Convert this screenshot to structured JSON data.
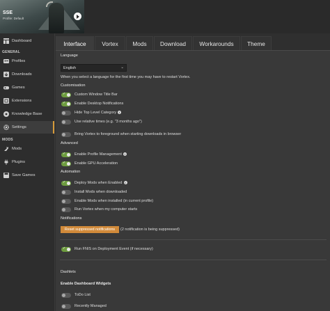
{
  "game": {
    "title": "SSE",
    "subtitle": "Profile: Default"
  },
  "sidebar": {
    "top_items": [
      {
        "label": "Dashboard",
        "icon": "dashboard-icon"
      }
    ],
    "general_label": "GENERAL",
    "general_items": [
      {
        "label": "Profiles",
        "icon": "profiles-icon"
      },
      {
        "label": "Downloads",
        "icon": "download-icon"
      },
      {
        "label": "Games",
        "icon": "gamepad-icon"
      },
      {
        "label": "Extensions",
        "icon": "extensions-icon"
      },
      {
        "label": "Knowledge Base",
        "icon": "knowledge-icon"
      },
      {
        "label": "Settings",
        "icon": "gear-icon",
        "active": true
      }
    ],
    "mods_label": "MODS",
    "mods_items": [
      {
        "label": "Mods",
        "icon": "mods-icon"
      },
      {
        "label": "Plugins",
        "icon": "plugins-icon"
      },
      {
        "label": "Save Games",
        "icon": "save-icon"
      }
    ]
  },
  "tabs": [
    {
      "label": "Interface",
      "active": true
    },
    {
      "label": "Vortex"
    },
    {
      "label": "Mods"
    },
    {
      "label": "Download"
    },
    {
      "label": "Workarounds"
    },
    {
      "label": "Theme"
    }
  ],
  "settings": {
    "language_label": "Language",
    "language_value": "English",
    "language_note": "When you select a language for the first time you may have to restart Vortex.",
    "customisation_label": "Customisation",
    "customisation": [
      {
        "label": "Custom Window Title Bar",
        "on": true
      },
      {
        "label": "Enable Desktop Notifications",
        "on": true
      },
      {
        "label": "Hide Top Level Category",
        "on": false,
        "info": true
      },
      {
        "label": "Use relative times (e.g. \"3 months ago\")",
        "on": false
      },
      {
        "label": "Bring Vortex to foreground when starting downloads in browser",
        "on": false
      }
    ],
    "advanced_label": "Advanced",
    "advanced": [
      {
        "label": "Enable Profile Management",
        "on": true,
        "info": true
      },
      {
        "label": "Enable GPU Acceleration",
        "on": true
      }
    ],
    "automation_label": "Automation",
    "automation": [
      {
        "label": "Deploy Mods when Enabled",
        "on": true,
        "info": true
      },
      {
        "label": "Install Mods when downloaded",
        "on": false
      },
      {
        "label": "Enable Mods when installed (in current profile)",
        "on": false
      },
      {
        "label": "Run Vortex when my computer starts",
        "on": false
      }
    ],
    "notifications_label": "Notifications",
    "reset_button": "Reset suppressed notifications",
    "reset_note": "(2 notification is being suppressed)",
    "fnis": {
      "label": "Run FNIS on Deployment Event (if necessary)",
      "on": true
    },
    "dashlets_label": "Dashlets",
    "dashboard_widgets_label": "Enable Dashboard Widgets",
    "widgets": [
      {
        "label": "ToDo List",
        "on": false
      },
      {
        "label": "Recently Managed",
        "on": false
      }
    ]
  },
  "colors": {
    "accent": "#d18a3a",
    "toggle_on": "#6d9c3f",
    "background": "#393939"
  }
}
